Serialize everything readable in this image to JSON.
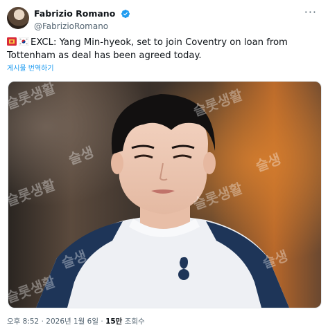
{
  "author": {
    "display_name": "Fabrizio Romano",
    "handle": "@FabrizioRomano",
    "verified_icon": "verified-badge-icon",
    "badge_color": "#1d9bf0"
  },
  "more_menu": {
    "icon": "more-options-icon",
    "label": "···"
  },
  "tweet": {
    "flags": [
      "flag-icon-coventry",
      "flag-icon-south-korea"
    ],
    "text": "EXCL: Yang Min-hyeok, set to join Coventry on loan from Tottenham as deal has been agreed today.",
    "translate_link": "게시물 번역하기"
  },
  "media": {
    "type": "photo",
    "watermark_text": "슬롯생활",
    "watermark_text_short": "슬생"
  },
  "meta": {
    "time": "오후 8:52",
    "separator": "·",
    "date": "2026년 1월 6일",
    "views_count": "15만",
    "views_label": "조회수"
  },
  "colors": {
    "accent": "#1d9bf0",
    "text_primary": "#0f1419",
    "text_secondary": "#536471"
  }
}
